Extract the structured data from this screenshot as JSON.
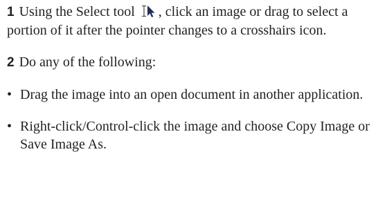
{
  "steps": [
    {
      "number": "1",
      "text_before_icon": "Using the Select tool",
      "icon": "select-tool-icon",
      "text_after_icon": ", click an image or drag to select a portion of it after the pointer changes to a crosshairs icon."
    },
    {
      "number": "2",
      "text": "Do any of the following:"
    }
  ],
  "bullet_symbol": "•",
  "bullets": [
    "Drag the image into an open document in another application.",
    "Right-click/Control-click the image and choose Copy Image or Save Image As."
  ],
  "colors": {
    "text": "#231f20",
    "icon_cursor": "#4a4a4a",
    "icon_arrow": "#1f2f55"
  }
}
